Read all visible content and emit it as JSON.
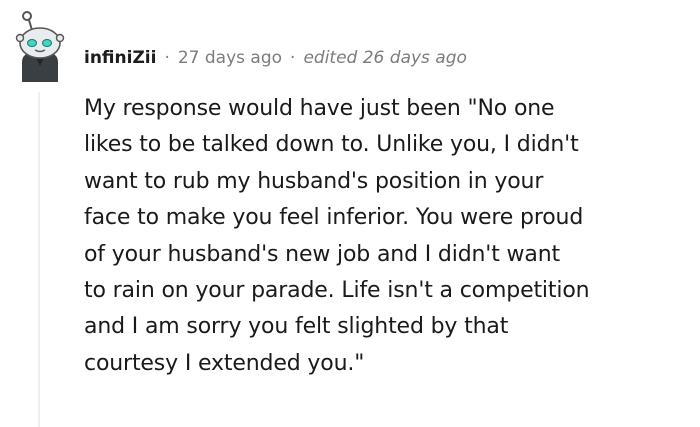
{
  "comment": {
    "username": "infiniZii",
    "separator": "·",
    "timestamp": "27 days ago",
    "edited": "edited 26 days ago",
    "body_lines": [
      "My response would have just been \"No one",
      "likes to be talked down to. Unlike you, I didn't",
      "want to rub my husband's position in your",
      "face to make you feel inferior. You were proud",
      "of your husband's new job and I didn't want",
      "to rain on your parade. Life isn't a competition",
      "and I am sorry you felt slighted by that",
      "courtesy I extended you.\""
    ]
  },
  "colors": {
    "text": "#1a1a1b",
    "meta": "#7c7c7c",
    "thread_line": "#edeff1",
    "avatar_face": "#e9ecef",
    "avatar_eyes": "#3fd6c2",
    "avatar_body": "#3a3f44"
  },
  "icons": {
    "avatar": "snoo-avatar-icon"
  }
}
